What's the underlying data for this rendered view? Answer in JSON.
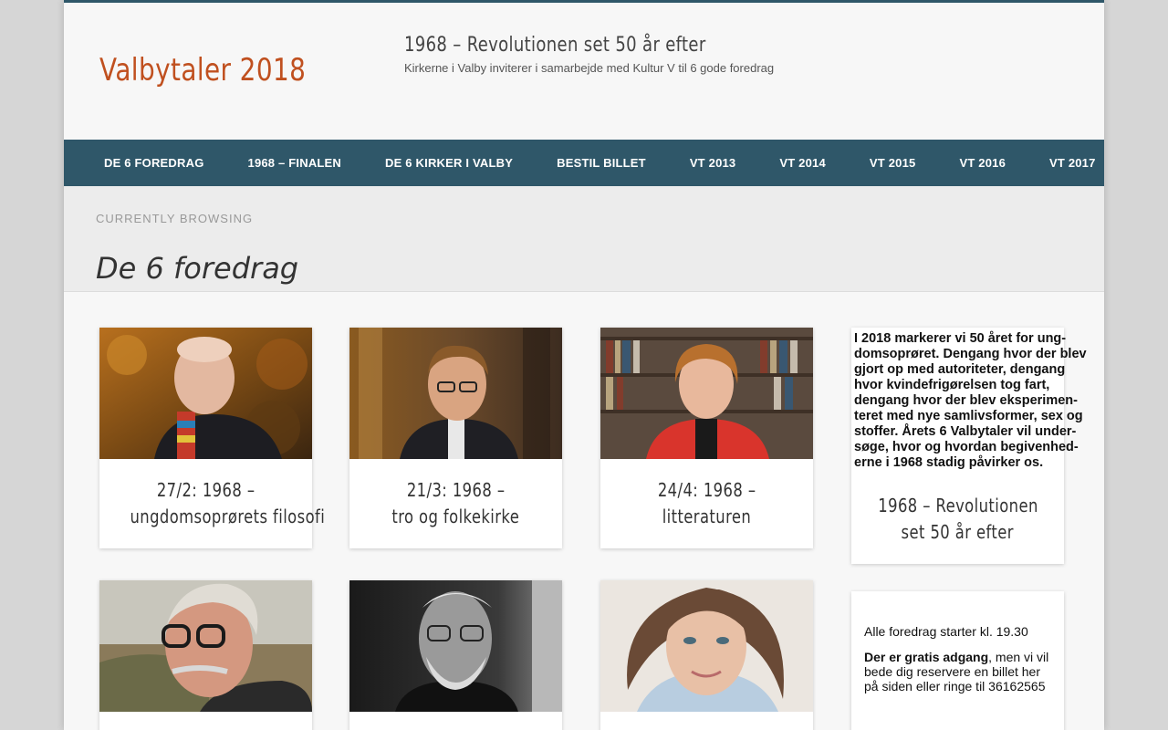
{
  "header": {
    "site_title": "Valbytaler 2018",
    "tagline_title": "1968 – Revolutionen set 50 år efter",
    "tagline_sub": "Kirkerne i Valby inviterer i samarbejde med Kultur V til 6 gode foredrag"
  },
  "nav": {
    "items": [
      "DE 6 FOREDRAG",
      "1968 – FINALEN",
      "DE 6 KIRKER I VALBY",
      "BESTIL BILLET",
      "VT 2013",
      "VT 2014",
      "VT 2015",
      "VT 2016",
      "VT 2017"
    ]
  },
  "browsing": {
    "label": "CURRENTLY BROWSING",
    "title": "De 6 foredrag"
  },
  "cards": [
    {
      "line1": "27/2: 1968 –",
      "line2": "ungdomsoprørets filosofi",
      "image": "portrait-bald-man-scarf"
    },
    {
      "line1": "21/3: 1968 –",
      "line2": "tro og folkekirke",
      "image": "portrait-man-glasses-church"
    },
    {
      "line1": "24/4: 1968 –",
      "line2": "litteraturen",
      "image": "portrait-woman-red-jacket"
    },
    {
      "image_text": [
        "I 2018 markerer vi 50 året for ung-",
        "domsoprøret. Dengang hvor der blev",
        "gjort op med autoriteter, dengang",
        "hvor kvindefrigørelsen tog fart,",
        "dengang hvor der blev eksperimen-",
        "teret med nye samlivsformer, sex og",
        "stoffer.  Årets 6 Valbytaler vil under-",
        "søge, hvor og hvordan begivenhed-",
        "erne i 1968 stadig påvirker os."
      ],
      "line1": "1968 – Revolutionen",
      "line2": "set 50 år efter"
    }
  ],
  "row2": [
    {
      "image": "portrait-man-grey-hair-glasses"
    },
    {
      "image": "portrait-bearded-man-bw"
    },
    {
      "image": "portrait-woman-smiling"
    }
  ],
  "notice": {
    "line1": "Alle foredrag starter kl. 19.30",
    "bold": "Der er gratis adgang",
    "rest": ", men vi vil bede dig reservere en billet her på siden eller ringe til 36162565"
  },
  "colors": {
    "accent": "#c0501f",
    "nav": "#2f5769"
  }
}
